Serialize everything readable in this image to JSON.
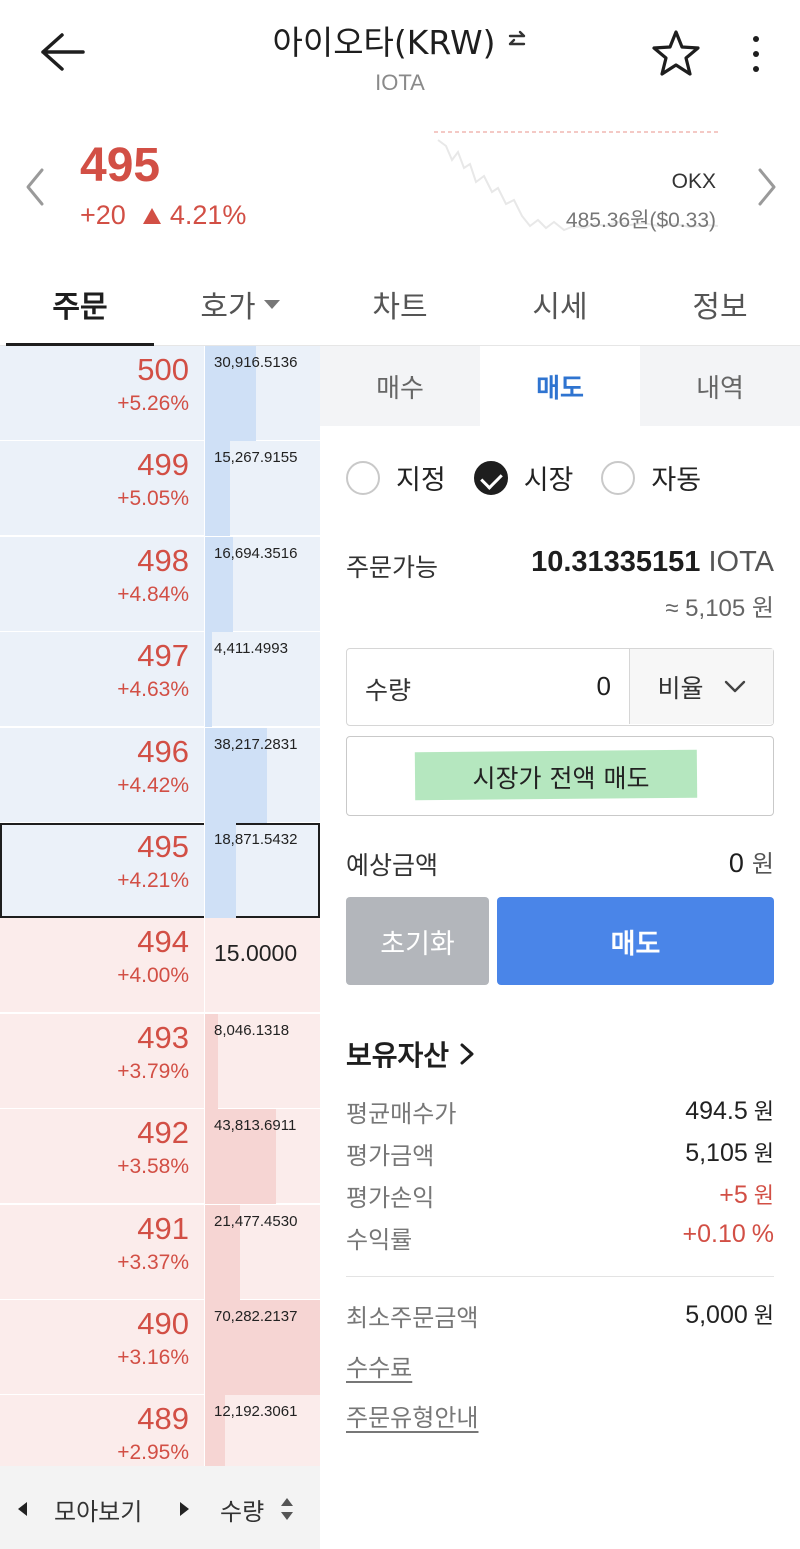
{
  "header": {
    "title": "아이오타(KRW)",
    "subtitle": "IOTA",
    "icons": [
      "back-arrow-icon",
      "swap-icon",
      "star-icon",
      "more-icon"
    ]
  },
  "price": {
    "current": "495",
    "change": "+20",
    "rate": "4.21%",
    "exchange": "OKX",
    "reference": "485.36원($0.33)",
    "color": "#d24f45"
  },
  "main_tabs": [
    "주문",
    "호가",
    "차트",
    "시세",
    "정보"
  ],
  "orderbook": {
    "asks": [
      {
        "price": "500",
        "rate": "+5.26%",
        "qty": "30,916.5136",
        "fill": 0.44
      },
      {
        "price": "499",
        "rate": "+5.05%",
        "qty": "15,267.9155",
        "fill": 0.22
      },
      {
        "price": "498",
        "rate": "+4.84%",
        "qty": "16,694.3516",
        "fill": 0.24
      },
      {
        "price": "497",
        "rate": "+4.63%",
        "qty": "4,411.4993",
        "fill": 0.06
      },
      {
        "price": "496",
        "rate": "+4.42%",
        "qty": "38,217.2831",
        "fill": 0.54
      },
      {
        "price": "495",
        "rate": "+4.21%",
        "qty": "18,871.5432",
        "fill": 0.27
      }
    ],
    "bids": [
      {
        "price": "494",
        "rate": "+4.00%",
        "qty": "15.0000",
        "fill": 0.0
      },
      {
        "price": "493",
        "rate": "+3.79%",
        "qty": "8,046.1318",
        "fill": 0.11
      },
      {
        "price": "492",
        "rate": "+3.58%",
        "qty": "43,813.6911",
        "fill": 0.62
      },
      {
        "price": "491",
        "rate": "+3.37%",
        "qty": "21,477.4530",
        "fill": 0.3
      },
      {
        "price": "490",
        "rate": "+3.16%",
        "qty": "70,282.2137",
        "fill": 1.0
      },
      {
        "price": "489",
        "rate": "+2.95%",
        "qty": "12,192.3061",
        "fill": 0.17
      }
    ],
    "footer": {
      "group_label": "모아보기",
      "qty_label": "수량"
    }
  },
  "order": {
    "sub_tabs": [
      "매수",
      "매도",
      "내역"
    ],
    "order_types": [
      "지정",
      "시장",
      "자동"
    ],
    "available_label": "주문가능",
    "available_amount": "10.31335151",
    "available_unit": "IOTA",
    "available_krw": "≈ 5,105 원",
    "qty_label": "수량",
    "qty_value": "0",
    "ratio_label": "비율",
    "market_sell_all": "시장가 전액 매도",
    "estimate_label": "예상금액",
    "estimate_value": "0",
    "estimate_unit": "원",
    "reset_label": "초기화",
    "sell_label": "매도"
  },
  "holdings": {
    "title": "보유자산",
    "rows": [
      {
        "label": "평균매수가",
        "value": "494.5",
        "unit": "원"
      },
      {
        "label": "평가금액",
        "value": "5,105",
        "unit": "원"
      },
      {
        "label": "평가손익",
        "value": "+5",
        "unit": "원"
      },
      {
        "label": "수익률",
        "value": "+0.10",
        "unit": "%"
      }
    ],
    "min_order_label": "최소주문금액",
    "min_order_value": "5,000",
    "min_order_unit": "원",
    "fee_link": "수수료",
    "order_type_guide": "주문유형안내"
  }
}
